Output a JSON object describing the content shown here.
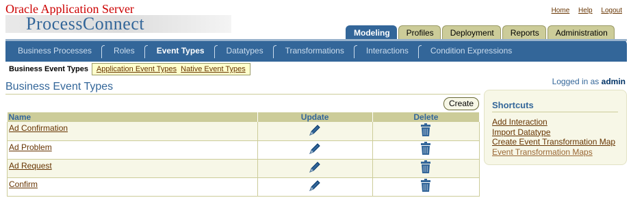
{
  "brand": {
    "product_line": "Oracle Application Server",
    "product_name": "ProcessConnect"
  },
  "global_links": [
    {
      "label": "Home"
    },
    {
      "label": "Help"
    },
    {
      "label": "Logout"
    }
  ],
  "top_tabs": [
    {
      "label": "Modeling",
      "active": true
    },
    {
      "label": "Profiles",
      "active": false
    },
    {
      "label": "Deployment",
      "active": false
    },
    {
      "label": "Reports",
      "active": false
    },
    {
      "label": "Administration",
      "active": false
    }
  ],
  "subnav": [
    {
      "label": "Business Processes",
      "active": false
    },
    {
      "label": "Roles",
      "active": false
    },
    {
      "label": "Event Types",
      "active": true
    },
    {
      "label": "Datatypes",
      "active": false
    },
    {
      "label": "Transformations",
      "active": false
    },
    {
      "label": "Interactions",
      "active": false
    },
    {
      "label": "Condition Expressions",
      "active": false
    }
  ],
  "subtabs": {
    "current": "Business Event Types",
    "links": [
      "Application Event Types",
      "Native Event Types"
    ]
  },
  "logged_in": {
    "prefix": "Logged in as",
    "user": "admin"
  },
  "page_title": "Business Event Types",
  "create_label": "Create",
  "table": {
    "headers": {
      "name": "Name",
      "update": "Update",
      "delete": "Delete"
    },
    "rows": [
      {
        "name": "Ad Confirmation"
      },
      {
        "name": "Ad Problem"
      },
      {
        "name": "Ad Request"
      },
      {
        "name": "Confirm"
      }
    ],
    "update_icon": "pencil-icon",
    "delete_icon": "trash-icon"
  },
  "shortcuts": {
    "title": "Shortcuts",
    "links": [
      {
        "label": "Add Interaction",
        "visited": false
      },
      {
        "label": "Import Datatype",
        "visited": false
      },
      {
        "label": "Create Event Transformation Map",
        "visited": false
      },
      {
        "label": "Event Transformation Maps",
        "visited": true
      }
    ]
  },
  "colors": {
    "brand_red": "#cc0000",
    "nav_blue": "#336699",
    "tab_tan": "#cccc99",
    "link_brown": "#663300",
    "row_shade": "#f7f7e7"
  }
}
